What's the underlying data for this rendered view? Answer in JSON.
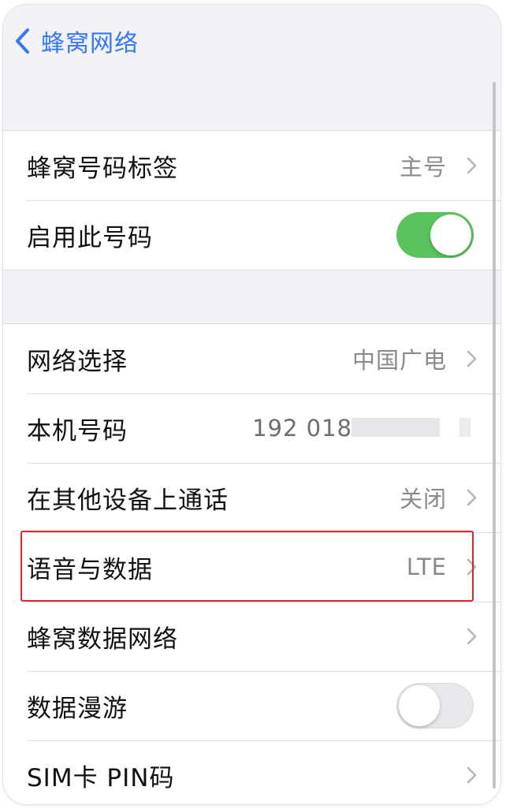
{
  "nav": {
    "back_label": "蜂窝网络"
  },
  "group1": [
    {
      "label": "蜂窝号码标签",
      "value": "主号",
      "type": "chevron"
    },
    {
      "label": "启用此号码",
      "type": "toggle",
      "on": true
    }
  ],
  "group2": [
    {
      "label": "网络选择",
      "value": "中国广电",
      "type": "chevron"
    },
    {
      "label": "本机号码",
      "value": "192 018",
      "type": "redacted"
    },
    {
      "label": "在其他设备上通话",
      "value": "关闭",
      "type": "chevron"
    },
    {
      "label": "语音与数据",
      "value": "LTE",
      "type": "chevron",
      "highlighted": true
    },
    {
      "label": "蜂窝数据网络",
      "value": "",
      "type": "chevron"
    },
    {
      "label": "数据漫游",
      "type": "toggle",
      "on": false
    },
    {
      "label": "SIM卡 PIN码",
      "value": "",
      "type": "chevron"
    }
  ],
  "colors": {
    "accent": "#3478f6",
    "toggle_on": "#5ac35d",
    "highlight_border": "#e0262c"
  }
}
